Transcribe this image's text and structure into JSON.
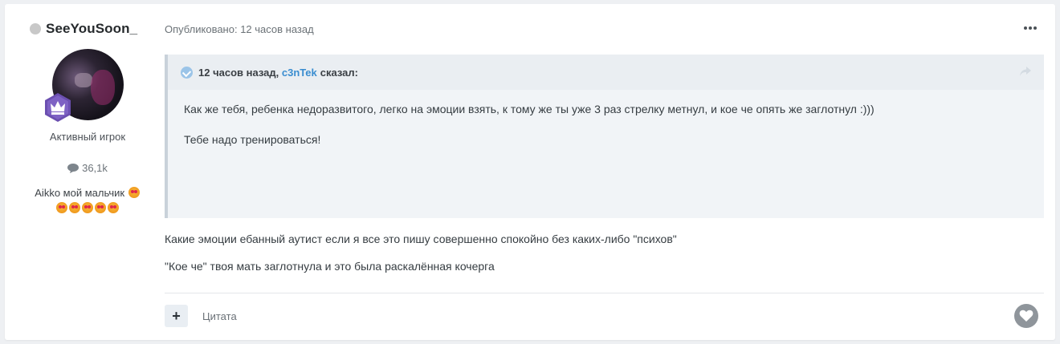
{
  "author": {
    "name": "SeeYouSoon_",
    "rank": "Активный игрок",
    "post_count": "36,1k",
    "signature": "Aikko мой мальчик"
  },
  "post": {
    "meta": "Опубликовано: 12 часов назад",
    "quote": {
      "time": "12 часов назад,",
      "user": "c3nTek",
      "said": "сказал:",
      "lines": [
        "Как же тебя, ребенка недоразвитого, легко на эмоции взять, к тому же ты уже 3 раз стрелку метнул, и кое че опять же заглотнул :)))",
        "Тебе надо тренироваться!"
      ]
    },
    "body": [
      "Какие эмоции ебанный аутист если я все это пишу совершенно спокойно без каких-либо \"психов\"",
      "\"Кое че\" твоя мать заглотнула и это была раскалённая кочерга"
    ],
    "actions": {
      "plus": "+",
      "quote": "Цитата"
    }
  },
  "icons": {
    "online": "status-dot-icon",
    "badge": "crown-badge-icon",
    "comments": "speech-bubble-icon",
    "more": "ellipsis-icon",
    "check": "check-circle-icon",
    "share": "share-arrow-icon",
    "like": "heart-icon"
  },
  "colors": {
    "accent": "#3a8dd0",
    "badge": "#6b4fb0",
    "quote_bg": "#f1f4f7"
  }
}
